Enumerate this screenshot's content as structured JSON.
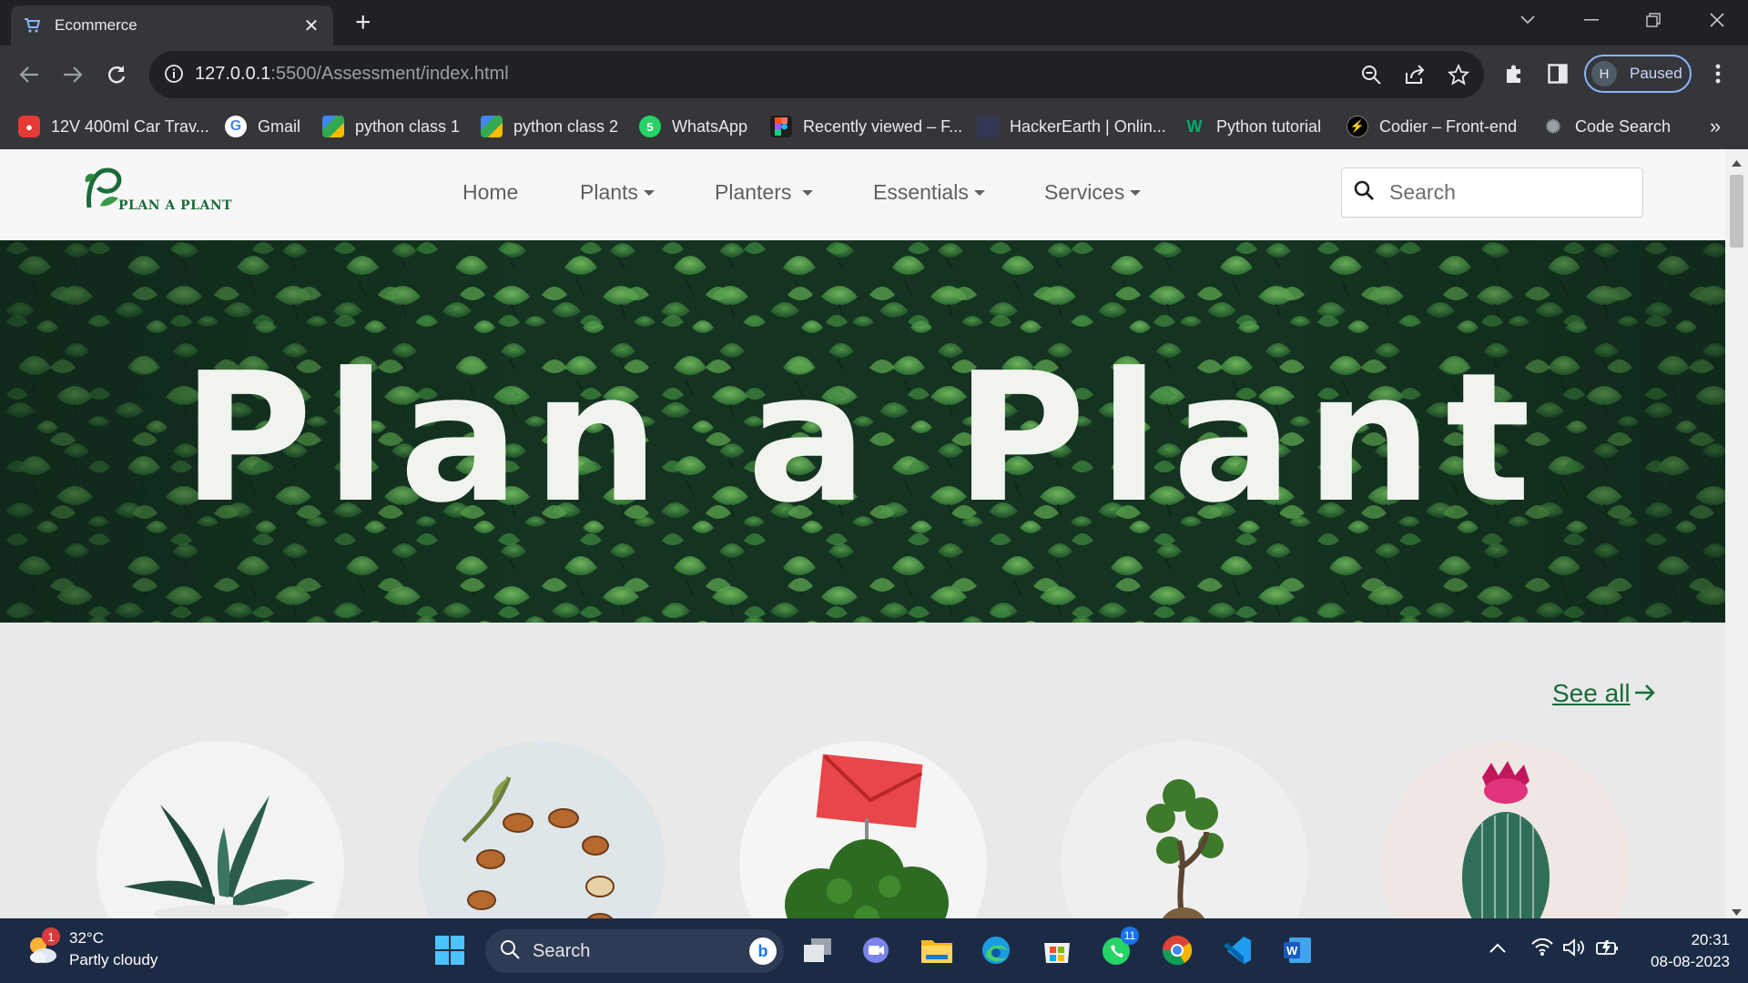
{
  "browser": {
    "tab_title": "Ecommerce",
    "tab_close": "✕",
    "new_tab": "+",
    "url_host": "127.0.0.1",
    "url_rest": ":5500/Assessment/index.html",
    "profile_initial": "H",
    "profile_status": "Paused",
    "bookmarks": [
      {
        "label": "12V 400ml Car Trav...",
        "icon": "car-shop-icon",
        "color": "#e53935"
      },
      {
        "label": "Gmail",
        "icon": "google-icon",
        "color": "#ffffff"
      },
      {
        "label": "python class 1",
        "icon": "meet-icon",
        "color": "#34a853"
      },
      {
        "label": "python class 2",
        "icon": "meet-icon",
        "color": "#34a853"
      },
      {
        "label": "WhatsApp",
        "icon": "whatsapp-icon",
        "color": "#25d366"
      },
      {
        "label": "Recently viewed – F...",
        "icon": "figma-icon",
        "color": "#f24e1e"
      },
      {
        "label": "HackerEarth | Onlin...",
        "icon": "hackerearth-icon",
        "color": "#323754"
      },
      {
        "label": "Python tutorial",
        "icon": "w3schools-icon",
        "color": "#04aa6d"
      },
      {
        "label": "Codier – Front-end",
        "icon": "codier-icon",
        "color": "#000000"
      },
      {
        "label": "Code Search",
        "icon": "code-search-icon",
        "color": "#9aa0a6"
      }
    ],
    "bookmarks_more": "»"
  },
  "site": {
    "logo_text": "PLAN A PLANT",
    "nav": [
      {
        "label": "Home",
        "dropdown": false
      },
      {
        "label": "Plants",
        "dropdown": true
      },
      {
        "label": "Planters",
        "dropdown": true
      },
      {
        "label": "Essentials",
        "dropdown": true
      },
      {
        "label": "Services",
        "dropdown": true
      }
    ],
    "search_placeholder": "Search",
    "hero_title": "Plan a Plant",
    "see_all": "See all",
    "categories": [
      "succulent",
      "argan-seeds",
      "gift-plant",
      "bonsai",
      "cactus"
    ]
  },
  "taskbar": {
    "weather_temp": "32°C",
    "weather_desc": "Partly cloudy",
    "weather_badge": "1",
    "search_placeholder": "Search",
    "whatsapp_badge": "11",
    "time": "20:31",
    "date": "08-08-2023"
  },
  "colors": {
    "brand_green": "#1b6b3a",
    "chrome_dark": "#202124",
    "chrome_toolbar": "#35363a",
    "taskbar": "#1c2b45"
  }
}
